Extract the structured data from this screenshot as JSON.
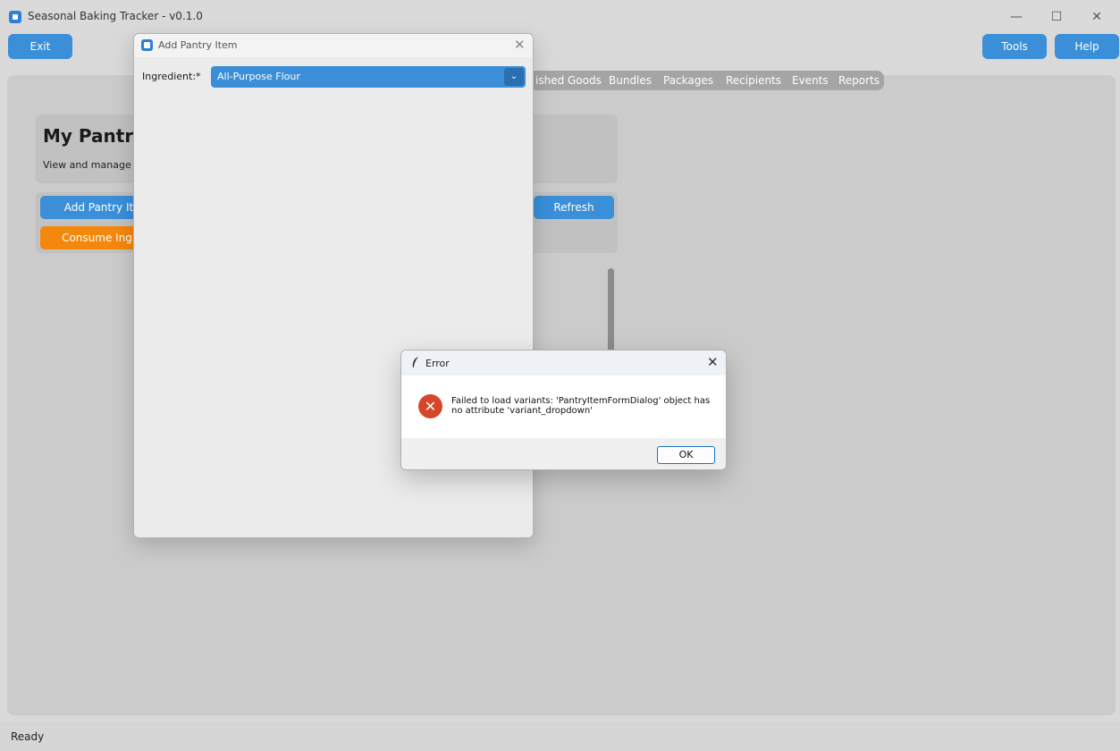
{
  "window": {
    "title": "Seasonal Baking Tracker - v0.1.0",
    "controls": {
      "minimize": "—",
      "maximize": "☐",
      "close": "✕"
    }
  },
  "toolbar": {
    "exit_label": "Exit",
    "tools_label": "Tools",
    "help_label": "Help"
  },
  "tabs": [
    "ished Goods",
    "Bundles",
    "Packages",
    "Recipients",
    "Events",
    "Reports"
  ],
  "pantry_page": {
    "title": "My Pantry",
    "subtitle": "View and manage yo",
    "add_button": "Add Pantry Item",
    "consume_button": "Consume Ingredi",
    "refresh_button": "Refresh"
  },
  "status": {
    "text": "Ready"
  },
  "pantry_dialog": {
    "title": "Add Pantry Item",
    "close": "✕",
    "ingredient_label": "Ingredient:*",
    "ingredient_value": "All-Purpose Flour",
    "dropdown_arrow": "⌄"
  },
  "error_dialog": {
    "title": "Error",
    "close": "✕",
    "icon_glyph": "✕",
    "message": "Failed to load variants: 'PantryItemFormDialog' object has no attribute 'variant_dropdown'",
    "ok_label": "OK"
  },
  "icons": {
    "app": "app-icon",
    "error": "error-icon",
    "feather": "feather-icon",
    "dropdown": "chevron-down-icon"
  },
  "colors": {
    "accent": "#3a8fd8",
    "warning": "#f3880c",
    "error": "#d4472a"
  }
}
